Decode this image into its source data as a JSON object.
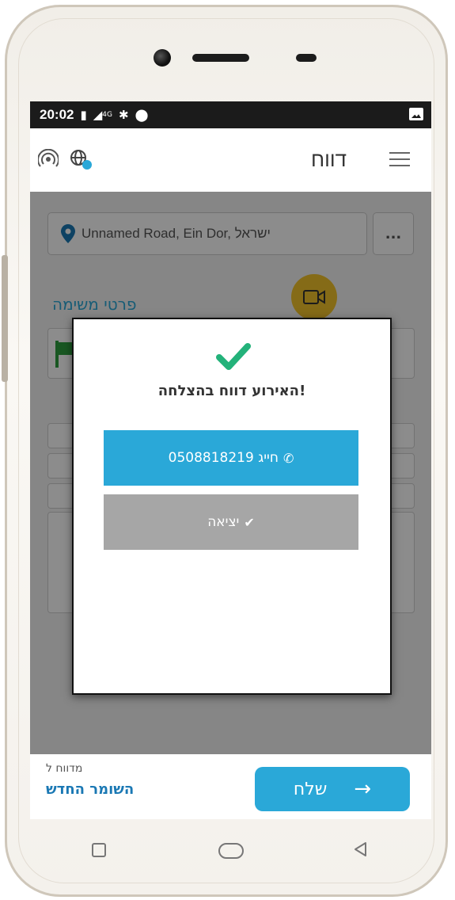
{
  "status_bar": {
    "time": "20:02",
    "network": "4G"
  },
  "app_bar": {
    "title": "דווח"
  },
  "location": {
    "address": "Unnamed Road, Ein Dor, ישראל",
    "more_label": "..."
  },
  "task_section": {
    "title": "פרטי משימה"
  },
  "dialog": {
    "message": "האירוע דווח בהצלחה!",
    "call_label": "חייג 0508818219",
    "exit_label": "יציאה"
  },
  "footer": {
    "reported_to_label": "מדווח ל",
    "guard_name": "השומר החדש",
    "send_label": "שלח"
  },
  "colors": {
    "accent": "#2aa8d8",
    "success": "#23b27a",
    "warning": "#f3c32a",
    "exit_gray": "#a6a6a6"
  }
}
